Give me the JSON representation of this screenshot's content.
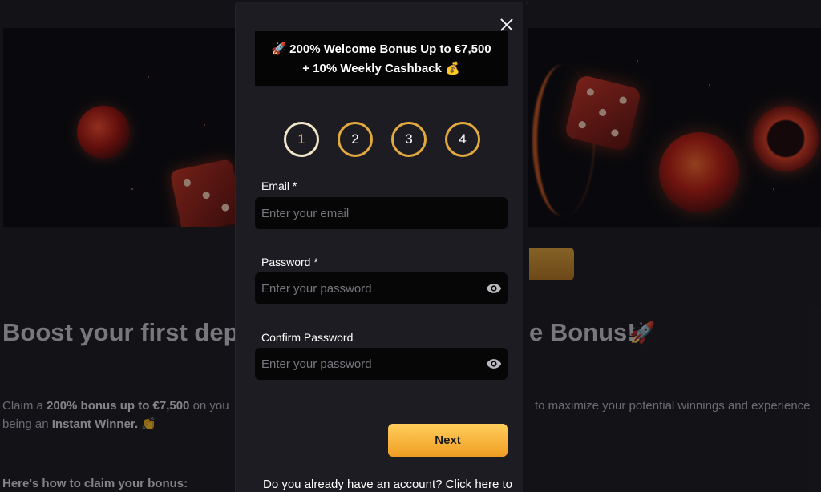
{
  "background": {
    "heading_left": "Boost your first depo",
    "heading_right": "e Bonus!",
    "heading_right_emoji": "🚀",
    "text_line1_pre": "Claim a ",
    "text_line1_bold": "200% bonus up to €7,500",
    "text_line1_post": " on you",
    "text_line1_right": "to maximize your potential winnings and experience",
    "text_line2_pre": "being an ",
    "text_line2_bold": "Instant Winner.",
    "text_line2_emoji": "👏",
    "subheading": "Here's how to claim your bonus:"
  },
  "modal": {
    "promo_line1": "🚀 200% Welcome Bonus Up to €7,500",
    "promo_line2": "+ 10% Weekly Cashback 💰",
    "steps": [
      "1",
      "2",
      "3",
      "4"
    ],
    "active_step": 1,
    "email": {
      "label": "Email *",
      "placeholder": "Enter your email",
      "value": ""
    },
    "password": {
      "label": "Password *",
      "placeholder": "Enter your password",
      "value": ""
    },
    "confirm_password": {
      "label": "Confirm Password",
      "placeholder": "Enter your password",
      "value": ""
    },
    "next_label": "Next",
    "footer_text": "Do you already have an account? Click here to"
  },
  "icons": {
    "close": "close-icon",
    "eye": "eye-icon"
  },
  "colors": {
    "accent_gold": "#e2a93f",
    "modal_bg": "#1d1c22",
    "input_bg": "#060607"
  }
}
